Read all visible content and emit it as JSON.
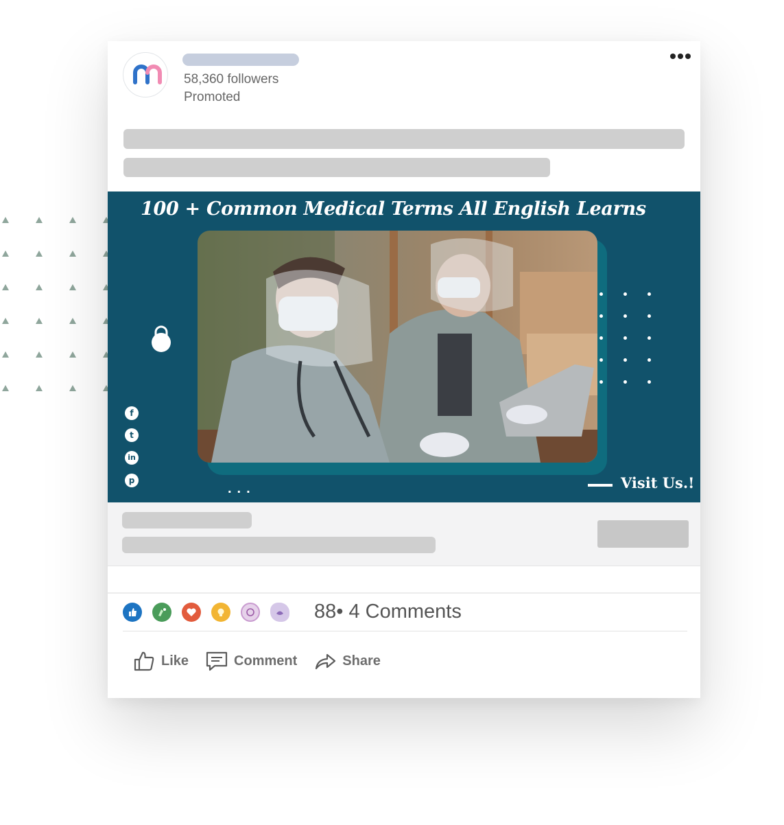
{
  "company": {
    "followers": "58,360 followers",
    "promoted": "Promoted"
  },
  "ad": {
    "headline": "100 + Common Medical Terms All English Learns",
    "cta": "Visit Us.!",
    "social_icons": [
      "facebook-icon",
      "twitter-icon",
      "linkedin-icon",
      "pinterest-icon"
    ]
  },
  "engagement": {
    "reactions": [
      "like-icon",
      "celebrate-icon",
      "love-icon",
      "insightful-icon",
      "curious-icon",
      "support-icon"
    ],
    "counts": "88• 4 Comments"
  },
  "actions": {
    "like": "Like",
    "comment": "Comment",
    "share": "Share"
  },
  "colors": {
    "ad_background": "#11526b",
    "skeleton": "#cfcfcf",
    "brand_blue": "#2f72c9",
    "brand_pink": "#f18bb3"
  }
}
